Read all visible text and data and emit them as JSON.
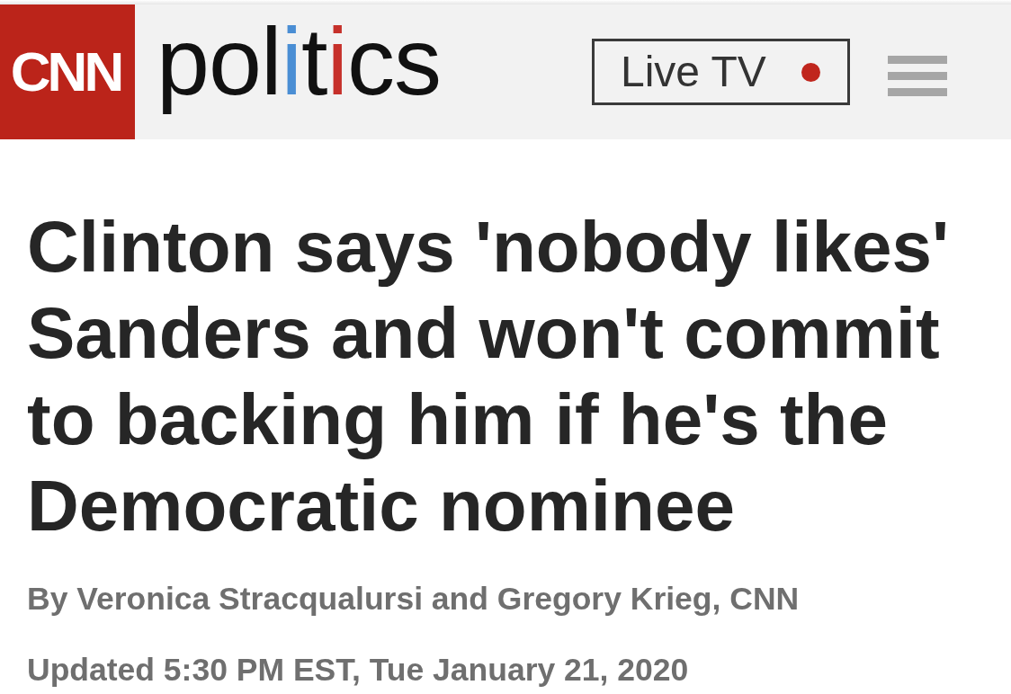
{
  "header": {
    "logo": "CNN",
    "section_wordmark": [
      {
        "text": "pol"
      },
      {
        "text": "i",
        "color": "#4a8ed4"
      },
      {
        "text": "t"
      },
      {
        "text": "i",
        "color": "#c6302a"
      },
      {
        "text": "cs"
      }
    ],
    "live_button": {
      "label": "Live TV",
      "live": true
    }
  },
  "article": {
    "headline": "Clinton says 'nobody likes' Sanders and won't commit to backing him if he's the Democratic nominee",
    "byline": "By Veronica Stracqualursi and Gregory Krieg, CNN",
    "timestamp": "Updated 5:30 PM EST, Tue January 21, 2020"
  }
}
